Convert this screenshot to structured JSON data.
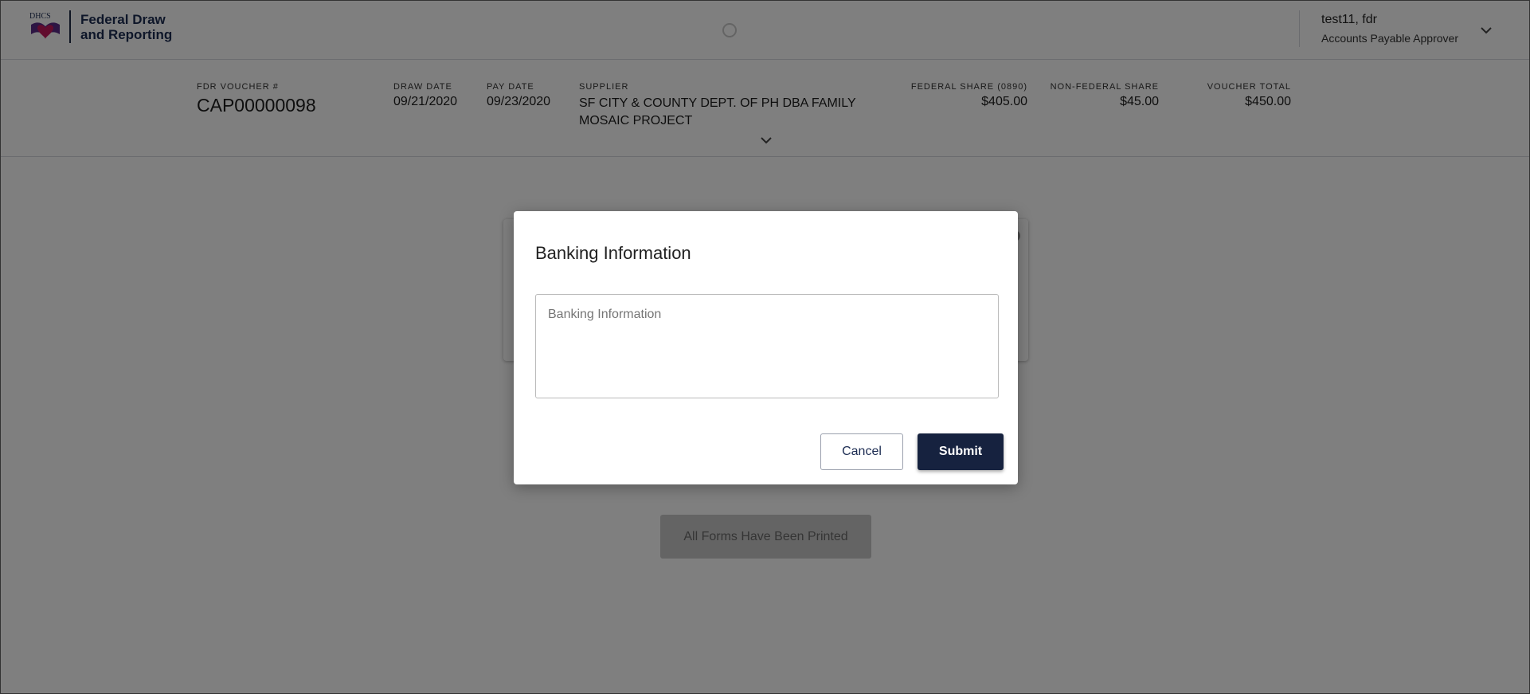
{
  "header": {
    "brand_line1": "Federal Draw",
    "brand_line2": "and Reporting",
    "logo_icon": "dhcs-logo",
    "user_name": "test11, fdr",
    "user_role": "Accounts Payable Approver"
  },
  "summary": {
    "voucher_label": "FDR VOUCHER #",
    "voucher_value": "CAP00000098",
    "draw_date_label": "DRAW DATE",
    "draw_date_value": "09/21/2020",
    "pay_date_label": "PAY DATE",
    "pay_date_value": "09/23/2020",
    "supplier_label": "SUPPLIER",
    "supplier_value": "SF CITY & COUNTY DEPT. OF PH DBA FAMILY MOSAIC PROJECT",
    "federal_share_label": "FEDERAL SHARE (0890)",
    "federal_share_value": "$405.00",
    "non_federal_share_label": "NON-FEDERAL SHARE",
    "non_federal_share_value": "$45.00",
    "voucher_total_label": "VOUCHER TOTAL",
    "voucher_total_value": "$450.00"
  },
  "body": {
    "printed_button_label": "All Forms Have Been Printed"
  },
  "modal": {
    "title": "Banking Information",
    "textarea_placeholder": "Banking Information",
    "textarea_value": "",
    "cancel_label": "Cancel",
    "submit_label": "Submit"
  },
  "colors": {
    "brand_navy": "#16223f",
    "overlay": "rgba(0,0,0,0.5)",
    "logo_pink": "#c2185b",
    "logo_purple": "#5b2a86"
  }
}
